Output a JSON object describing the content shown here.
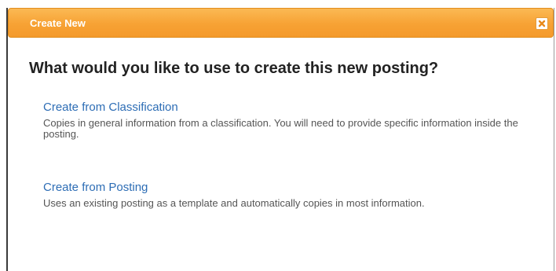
{
  "dialog": {
    "title": "Create New",
    "close_icon": "close-icon",
    "heading": "What would you like to use to create this new posting?",
    "options": [
      {
        "label": "Create from Classification",
        "description": "Copies in general information from a classification. You will need to provide specific information inside the posting."
      },
      {
        "label": "Create from Posting",
        "description": "Uses an existing posting as a template and automatically copies in most information."
      }
    ]
  },
  "colors": {
    "titlebar": "#f7a234",
    "link": "#2d6db5",
    "heading": "#222222",
    "description": "#555555"
  }
}
